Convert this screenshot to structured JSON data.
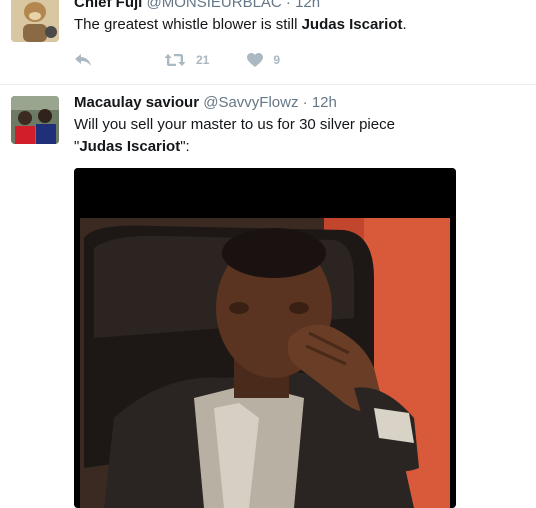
{
  "tweets": [
    {
      "name": "Chief Fuji",
      "handle": "@MONSIEURBLAC",
      "separator": "·",
      "time": "12h",
      "text_prefix": "The greatest whistle blower is still ",
      "text_bold": "Judas Iscariot",
      "text_suffix": ".",
      "retweet_count": "21",
      "like_count": "9"
    },
    {
      "name": "Macaulay saviour",
      "handle": "@SavvyFlowz",
      "separator": "·",
      "time": "12h",
      "text_line1": "Will you sell your master to us for 30 silver piece",
      "text_quote_open": "\"",
      "text_bold": "Judas Iscariot",
      "text_quote_close": "\":"
    }
  ],
  "colors": {
    "secondary_text": "#657786",
    "action_icon": "#aab8c2",
    "divider": "#e6ecf0"
  },
  "icons": [
    "reply-icon",
    "retweet-icon",
    "heart-icon"
  ]
}
